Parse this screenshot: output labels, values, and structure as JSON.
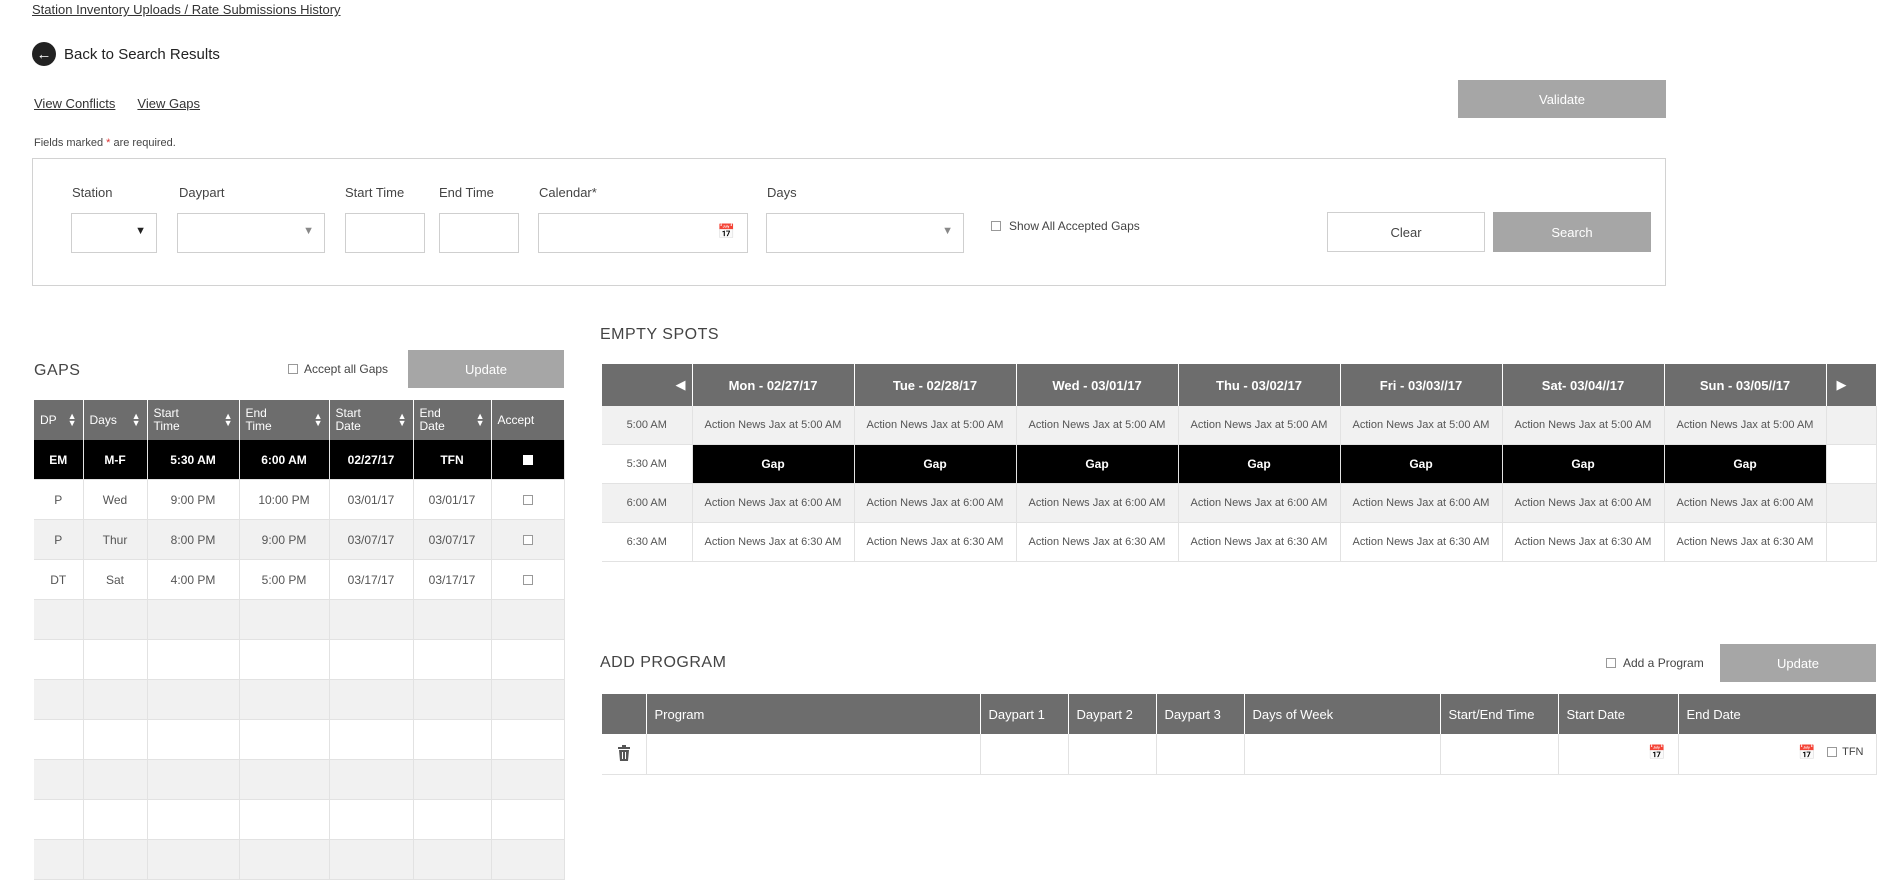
{
  "breadcrumb": "Station Inventory Uploads / Rate Submissions History",
  "back_label": "Back to Search Results",
  "links": {
    "view_conflicts": "View Conflicts",
    "view_gaps": "View Gaps"
  },
  "validate_label": "Validate",
  "required_note": {
    "prefix": "Fields marked ",
    "star": "*",
    "suffix": " are required."
  },
  "filters": {
    "station_label": "Station",
    "daypart_label": "Daypart",
    "start_time_label": "Start Time",
    "end_time_label": "End Time",
    "calendar_label": "Calendar*",
    "days_label": "Days",
    "show_accepted_label": "Show All Accepted Gaps",
    "clear_label": "Clear",
    "search_label": "Search"
  },
  "gaps": {
    "title": "GAPS",
    "accept_all_label": "Accept all Gaps",
    "update_label": "Update",
    "headers": [
      "DP",
      "Days",
      "Start Time",
      "End Time",
      "Start Date",
      "End Date",
      "Accept"
    ],
    "rows": [
      [
        "EM",
        "M-F",
        "5:30 AM",
        "6:00 AM",
        "02/27/17",
        "TFN"
      ],
      [
        "P",
        "Wed",
        "9:00 PM",
        "10:00 PM",
        "03/01/17",
        "03/01/17"
      ],
      [
        "P",
        "Thur",
        "8:00 PM",
        "9:00 PM",
        "03/07/17",
        "03/07/17"
      ],
      [
        "DT",
        "Sat",
        "4:00 PM",
        "5:00 PM",
        "03/17/17",
        "03/17/17"
      ]
    ]
  },
  "empty_spots": {
    "title": "EMPTY SPOTS",
    "prev_icon": "◀",
    "next_icon": "▶",
    "days": [
      "Mon - 02/27/17",
      "Tue - 02/28/17",
      "Wed - 03/01/17",
      "Thu - 03/02/17",
      "Fri - 03/03//17",
      "Sat- 03/04//17",
      "Sun - 03/05//17"
    ],
    "rows": [
      {
        "time": "5:00 AM",
        "cells": [
          "Action News Jax at 5:00 AM",
          "Action News Jax at 5:00 AM",
          "Action News Jax at 5:00 AM",
          "Action News Jax at 5:00 AM",
          "Action News Jax at 5:00 AM",
          "Action News Jax at 5:00 AM",
          "Action News Jax at 5:00 AM"
        ]
      },
      {
        "time": "5:30 AM",
        "cells": [
          "Gap",
          "Gap",
          "Gap",
          "Gap",
          "Gap",
          "Gap",
          "Gap"
        ]
      },
      {
        "time": "6:00 AM",
        "cells": [
          "Action News Jax at 6:00 AM",
          "Action News Jax at 6:00 AM",
          "Action News Jax at 6:00 AM",
          "Action News Jax at 6:00 AM",
          "Action News Jax at 6:00 AM",
          "Action News Jax at 6:00 AM",
          "Action News Jax at 6:00 AM"
        ]
      },
      {
        "time": "6:30 AM",
        "cells": [
          "Action News Jax at 6:30 AM",
          "Action News Jax at 6:30 AM",
          "Action News Jax at 6:30 AM",
          "Action News Jax at 6:30 AM",
          "Action News Jax at 6:30 AM",
          "Action News Jax at 6:30 AM",
          "Action News Jax at 6:30 AM"
        ]
      }
    ]
  },
  "add_program": {
    "title": "ADD PROGRAM",
    "add_label": "Add a Program",
    "update_label": "Update",
    "headers": [
      "Program",
      "Daypart 1",
      "Daypart 2",
      "Daypart  3",
      "Days of Week",
      "Start/End Time",
      "Start Date",
      "End Date"
    ],
    "tfn_label": "TFN"
  },
  "icons": {
    "back": "arrow-left-circle-icon",
    "calendar": "calendar-icon",
    "trash": "trash-icon",
    "caret": "caret-down-icon",
    "sort": "sort-icon"
  }
}
